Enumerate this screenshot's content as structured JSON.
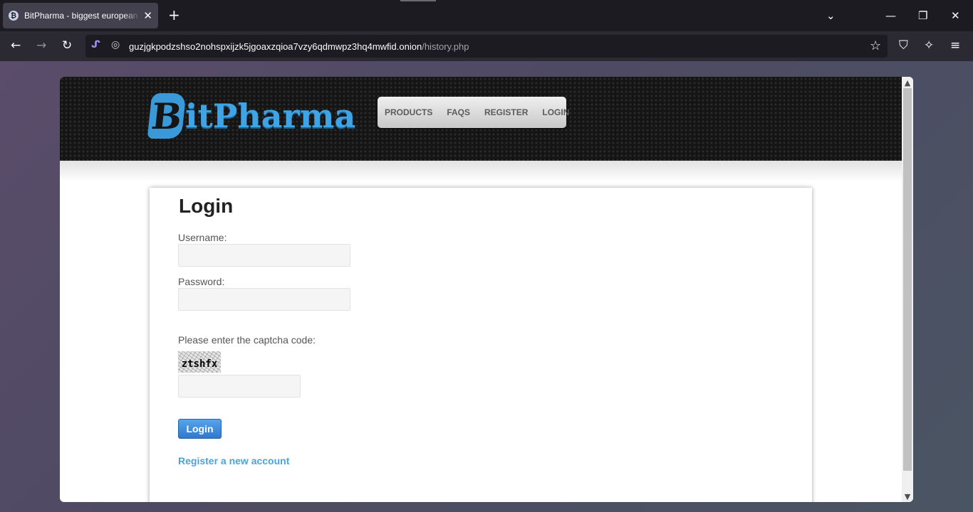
{
  "browser": {
    "tab_title": "BitPharma - biggest european .",
    "tab_favicon": "₿",
    "tab_close": "✕",
    "new_tab": "+",
    "list_tabs": "⌄",
    "minimize": "—",
    "restore": "❐",
    "close": "✕",
    "back": "←",
    "forward": "→",
    "reload": "↻",
    "url_host": "guzjgkpodzshso2nohspxijzk5jgoaxzqioa7vzy6qdmwpz3hq4mwfid.onion",
    "url_path": "/history.php",
    "bookmark": "☆",
    "shield": "⛉",
    "extensions": "✧",
    "menu": "≡"
  },
  "site": {
    "logo_letter": "B",
    "logo_text": "itPharma",
    "nav": [
      {
        "label": "PRODUCTS"
      },
      {
        "label": "FAQS"
      },
      {
        "label": "REGISTER"
      },
      {
        "label": "LOGIN"
      }
    ]
  },
  "form": {
    "title": "Login",
    "username_label": "Username:",
    "username_value": "",
    "password_label": "Password:",
    "password_value": "",
    "captcha_label": "Please enter the captcha code:",
    "captcha_text": "ztshfx",
    "captcha_value": "",
    "submit_label": "Login",
    "register_link": "Register a new account"
  },
  "colors": {
    "accent": "#3fa4e6",
    "button": "#2f78cf",
    "link": "#4aa3df"
  }
}
